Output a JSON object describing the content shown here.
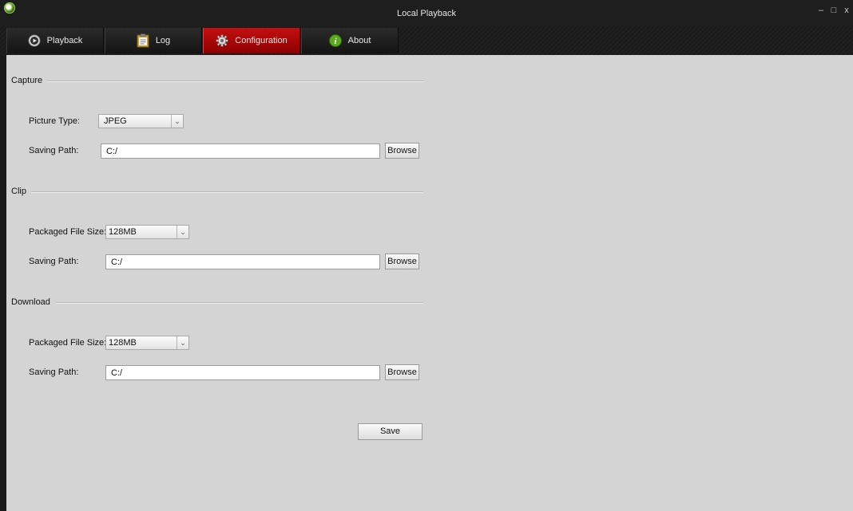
{
  "window": {
    "title": "Local Playback",
    "controls": {
      "minimize": "–",
      "maximize": "□",
      "close": "x"
    },
    "logo_icon": "app-logo-icon"
  },
  "tabs": [
    {
      "label": "Playback",
      "icon": "play-circle-icon",
      "active": false
    },
    {
      "label": "Log",
      "icon": "log-clipboard-icon",
      "active": false
    },
    {
      "label": "Configuration",
      "icon": "gear-icon",
      "active": true
    },
    {
      "label": "About",
      "icon": "info-icon",
      "active": false
    }
  ],
  "capture": {
    "title": "Capture",
    "picture_type_label": "Picture Type:",
    "picture_type_value": "JPEG",
    "saving_path_label": "Saving Path:",
    "saving_path_value": "C:/",
    "browse_label": "Browse"
  },
  "clip": {
    "title": "Clip",
    "file_size_label": "Packaged File Size:",
    "file_size_value": "128MB",
    "saving_path_label": "Saving Path:",
    "saving_path_value": "C:/",
    "browse_label": "Browse"
  },
  "download": {
    "title": "Download",
    "file_size_label": "Packaged File Size:",
    "file_size_value": "128MB",
    "saving_path_label": "Saving Path:",
    "saving_path_value": "C:/",
    "browse_label": "Browse"
  },
  "save_label": "Save",
  "colors": {
    "active_tab": "#c40f0f",
    "content_bg": "#d4d4d4",
    "chrome_bg": "#1a1a1a"
  }
}
